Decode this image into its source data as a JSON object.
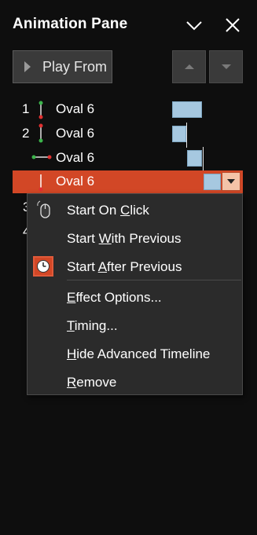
{
  "header": {
    "title": "Animation Pane"
  },
  "toolbar": {
    "play_label": "Play From"
  },
  "animations": [
    {
      "num": "1",
      "name": "Oval 6"
    },
    {
      "num": "2",
      "name": "Oval 6"
    },
    {
      "num": "",
      "name": "Oval 6"
    },
    {
      "num": "",
      "name": "Oval 6"
    }
  ],
  "hidden_numbers": [
    "3",
    "4"
  ],
  "context_menu": {
    "start_on_click": {
      "pre": "Start On ",
      "u": "C",
      "post": "lick"
    },
    "start_with_previous": {
      "pre": "Start ",
      "u": "W",
      "post": "ith Previous"
    },
    "start_after_previous": {
      "pre": "Start ",
      "u": "A",
      "post": "fter Previous"
    },
    "effect_options": {
      "pre": "",
      "u": "E",
      "post": "ffect Options..."
    },
    "timing": {
      "pre": "",
      "u": "T",
      "post": "iming..."
    },
    "hide_advanced_timeline": {
      "pre": "",
      "u": "H",
      "post": "ide Advanced Timeline"
    },
    "remove": {
      "pre": "",
      "u": "R",
      "post": "emove"
    }
  },
  "colors": {
    "accent": "#d24726",
    "bar": "#a6c8e0",
    "background": "#0e0e0e",
    "menu": "#2b2b2b"
  }
}
